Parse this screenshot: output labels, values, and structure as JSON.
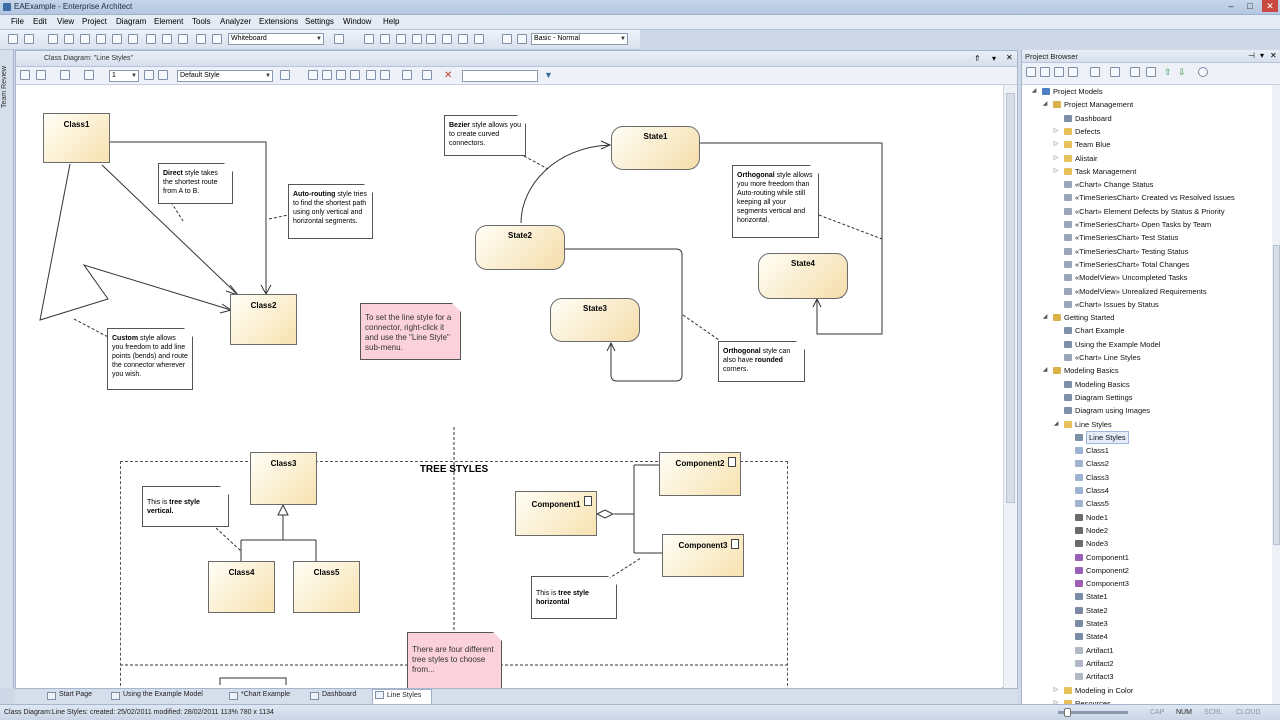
{
  "window": {
    "title": "EAExample - Enterprise Architect"
  },
  "menu": [
    "File",
    "Edit",
    "View",
    "Project",
    "Diagram",
    "Element",
    "Tools",
    "Analyzer",
    "Extensions",
    "Settings",
    "Window",
    "Help"
  ],
  "toolbar": {
    "perspective": "Whiteboard",
    "workspace": "Basic - Normal"
  },
  "side_strip": {
    "label": "Team Review"
  },
  "diagram": {
    "header": "Class Diagram: \"Line Styles\"",
    "style_combo": "Default Style",
    "zoom_combo": "1",
    "classes": {
      "c1": "Class1",
      "c2": "Class2",
      "c3": "Class3",
      "c4": "Class4",
      "c5": "Class5"
    },
    "states": {
      "s1": "State1",
      "s2": "State2",
      "s3": "State3",
      "s4": "State4"
    },
    "components": {
      "k1": "Component1",
      "k2": "Component2",
      "k3": "Component3"
    },
    "notes": {
      "direct": [
        "Direct",
        " style takes the shortest route from A to B."
      ],
      "auto": [
        "Auto-routing",
        " style tries to find the shortest path using only vertical and horizontal segments."
      ],
      "custom": [
        "Custom",
        " style allows you freedom to add line points (bends) and route the connector wherever you wish."
      ],
      "bezier": [
        "Bezier",
        " style allows you to create curved connectors."
      ],
      "orth1": [
        "Orthogonal",
        " style allows you more freedom than Auto-routing while still keeping all your segments vertical and horizontal."
      ],
      "orth2_a": "Orthogonal",
      "orth2_b": " style can also have ",
      "orth2_c": "rounded",
      "orth2_d": " corners.",
      "pink1": "To set the line style for a connector, right-click it and use the \"Line Style\" sub-menu.",
      "vert_a": "This is ",
      "vert_b": "tree style vertical.",
      "horiz_a": "This is ",
      "horiz_b": "tree style horizontal",
      "pink2": "There are four different tree styles to choose from..."
    },
    "tree_title": "TREE STYLES"
  },
  "tabs": [
    "Start Page",
    "Using the Example Model",
    "*Chart Example",
    "Dashboard",
    "Line Styles"
  ],
  "status": {
    "text": "Class Diagram:Line Styles:  created: 25/02/2011  modified: 28/02/2011  113%  780 x 1134",
    "keys": [
      "CAP",
      "NUM",
      "SCRL",
      "CLOUD"
    ]
  },
  "browser": {
    "title": "Project Browser",
    "items": [
      {
        "label": "Project Models",
        "level": 0,
        "icon": "model-icon",
        "exp": "◢"
      },
      {
        "label": "Project Management",
        "level": 1,
        "icon": "package-icon",
        "exp": "◢"
      },
      {
        "label": "Dashboard",
        "level": 2,
        "icon": "diagram-icon",
        "exp": ""
      },
      {
        "label": "Defects",
        "level": 2,
        "icon": "folder-icon",
        "exp": "▷"
      },
      {
        "label": "Team Blue",
        "level": 2,
        "icon": "folder-icon",
        "exp": "▷"
      },
      {
        "label": "Alistair",
        "level": 2,
        "icon": "folder-icon",
        "exp": "▷"
      },
      {
        "label": "Task Management",
        "level": 2,
        "icon": "folder-icon",
        "exp": "▷"
      },
      {
        "label": "«Chart» Change Status",
        "level": 2,
        "icon": "chart-icon",
        "exp": ""
      },
      {
        "label": "«TimeSeriesChart» Created vs Resolved Issues",
        "level": 2,
        "icon": "chart-icon",
        "exp": ""
      },
      {
        "label": "«Chart» Element Defects by Status & Priority",
        "level": 2,
        "icon": "chart-icon",
        "exp": ""
      },
      {
        "label": "«TimeSeriesChart» Open Tasks by Team",
        "level": 2,
        "icon": "chart-icon",
        "exp": ""
      },
      {
        "label": "«TimeSeriesChart» Test Status",
        "level": 2,
        "icon": "chart-icon",
        "exp": ""
      },
      {
        "label": "«TimeSeriesChart» Testing Status",
        "level": 2,
        "icon": "chart-icon",
        "exp": ""
      },
      {
        "label": "«TimeSeriesChart» Total Changes",
        "level": 2,
        "icon": "chart-icon",
        "exp": ""
      },
      {
        "label": "«ModelView» Uncompleted Tasks",
        "level": 2,
        "icon": "chart-icon",
        "exp": ""
      },
      {
        "label": "«ModelView» Unrealized Requirements",
        "level": 2,
        "icon": "chart-icon",
        "exp": ""
      },
      {
        "label": "«Chart» Issues by Status",
        "level": 2,
        "icon": "chart-icon",
        "exp": ""
      },
      {
        "label": "Getting Started",
        "level": 1,
        "icon": "package-icon",
        "exp": "◢"
      },
      {
        "label": "Chart Example",
        "level": 2,
        "icon": "diagram-icon",
        "exp": ""
      },
      {
        "label": "Using the Example Model",
        "level": 2,
        "icon": "diagram-icon",
        "exp": ""
      },
      {
        "label": "«Chart» Line Styles",
        "level": 2,
        "icon": "chart-icon",
        "exp": ""
      },
      {
        "label": "Modeling Basics",
        "level": 1,
        "icon": "package-icon",
        "exp": "◢"
      },
      {
        "label": "Modeling Basics",
        "level": 2,
        "icon": "diagram-icon",
        "exp": ""
      },
      {
        "label": "Diagram Settings",
        "level": 2,
        "icon": "diagram-icon",
        "exp": ""
      },
      {
        "label": "Diagram using Images",
        "level": 2,
        "icon": "diagram-icon",
        "exp": ""
      },
      {
        "label": "Line Styles",
        "level": 2,
        "icon": "folder-icon",
        "exp": "◢"
      },
      {
        "label": "Line Styles",
        "level": 3,
        "icon": "diagram-icon",
        "exp": "",
        "selected": true
      },
      {
        "label": "Class1",
        "level": 3,
        "icon": "class-icon",
        "exp": ""
      },
      {
        "label": "Class2",
        "level": 3,
        "icon": "class-icon",
        "exp": ""
      },
      {
        "label": "Class3",
        "level": 3,
        "icon": "class-icon",
        "exp": ""
      },
      {
        "label": "Class4",
        "level": 3,
        "icon": "class-icon",
        "exp": ""
      },
      {
        "label": "Class5",
        "level": 3,
        "icon": "class-icon",
        "exp": ""
      },
      {
        "label": "Node1",
        "level": 3,
        "icon": "node-icon",
        "exp": ""
      },
      {
        "label": "Node2",
        "level": 3,
        "icon": "node-icon",
        "exp": ""
      },
      {
        "label": "Node3",
        "level": 3,
        "icon": "node-icon",
        "exp": ""
      },
      {
        "label": "Component1",
        "level": 3,
        "icon": "component-icon",
        "exp": ""
      },
      {
        "label": "Component2",
        "level": 3,
        "icon": "component-icon",
        "exp": ""
      },
      {
        "label": "Component3",
        "level": 3,
        "icon": "component-icon",
        "exp": ""
      },
      {
        "label": "State1",
        "level": 3,
        "icon": "state-icon",
        "exp": ""
      },
      {
        "label": "State2",
        "level": 3,
        "icon": "state-icon",
        "exp": ""
      },
      {
        "label": "State3",
        "level": 3,
        "icon": "state-icon",
        "exp": ""
      },
      {
        "label": "State4",
        "level": 3,
        "icon": "state-icon",
        "exp": ""
      },
      {
        "label": "Artifact1",
        "level": 3,
        "icon": "artifact-icon",
        "exp": ""
      },
      {
        "label": "Artifact2",
        "level": 3,
        "icon": "artifact-icon",
        "exp": ""
      },
      {
        "label": "Artifact3",
        "level": 3,
        "icon": "artifact-icon",
        "exp": ""
      },
      {
        "label": "Modeling in Color",
        "level": 2,
        "icon": "folder-icon",
        "exp": "▷"
      },
      {
        "label": "Resources",
        "level": 2,
        "icon": "folder-icon",
        "exp": "▷"
      }
    ]
  },
  "colors": {
    "accent": "#3a6ea5",
    "element_fill": "#f7e2b0",
    "note_pink": "#fbd2dc"
  }
}
